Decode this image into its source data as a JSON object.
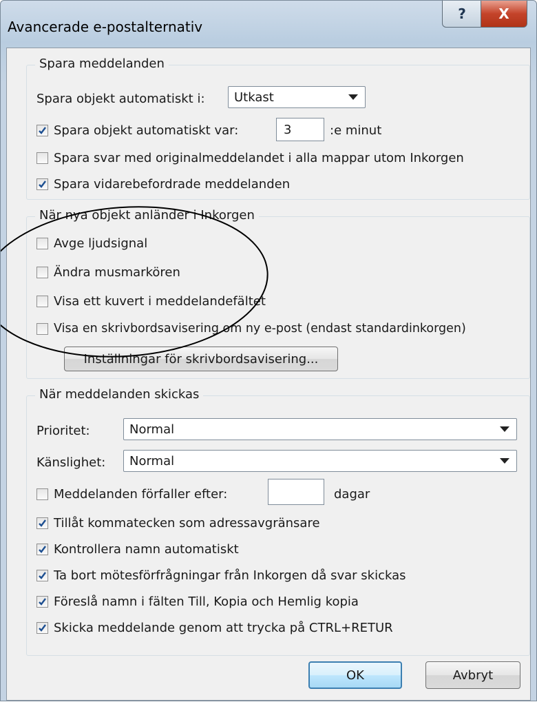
{
  "window": {
    "title": "Avancerade e-postalternativ",
    "help_glyph": "?",
    "close_glyph": "X",
    "accent_color": "#b03418"
  },
  "save_group": {
    "title": "Spara meddelanden",
    "autosave_in_label": "Spara objekt automatiskt i:",
    "autosave_in_value": "Utkast",
    "autosave_every_label": "Spara objekt automatiskt var:",
    "autosave_every_checked": true,
    "autosave_minutes": "3",
    "minutes_suffix": ":e minut",
    "save_replies_label": "Spara svar med originalmeddelandet i alla mappar utom Inkorgen",
    "save_replies_checked": false,
    "save_forwarded_label": "Spara vidarebefordrade meddelanden",
    "save_forwarded_checked": true
  },
  "arrive_group": {
    "title": "När nya objekt anländer i Inkorgen",
    "sound_label": "Avge ljudsignal",
    "sound_checked": false,
    "pointer_label": "Ändra musmarkören",
    "pointer_checked": false,
    "envelope_label": "Visa ett kuvert i meddelandefältet",
    "envelope_checked": false,
    "desktop_alert_label": "Visa en skrivbordsavisering om ny e-post (endast standardinkorgen)",
    "desktop_alert_checked": false,
    "desktop_settings_button": "Inställningar för skrivbordsavisering..."
  },
  "send_group": {
    "title": "När meddelanden skickas",
    "priority_label": "Prioritet:",
    "priority_value": "Normal",
    "sensitivity_label": "Känslighet:",
    "sensitivity_value": "Normal",
    "expire_label": "Meddelanden förfaller efter:",
    "expire_checked": false,
    "expire_value": "",
    "expire_unit": "dagar",
    "comma_label": "Tillåt kommatecken som adressavgränsare",
    "comma_checked": true,
    "check_names_label": "Kontrollera namn automatiskt",
    "check_names_checked": true,
    "delete_meeting_label": "Ta bort mötesförfrågningar från Inkorgen då svar skickas",
    "delete_meeting_checked": true,
    "suggest_names_label": "Föreslå namn i fälten Till, Kopia och Hemlig kopia",
    "suggest_names_checked": true,
    "ctrl_enter_label": "Skicka meddelande genom att trycka på CTRL+RETUR",
    "ctrl_enter_checked": true
  },
  "footer": {
    "ok_label": "OK",
    "cancel_label": "Avbryt"
  }
}
